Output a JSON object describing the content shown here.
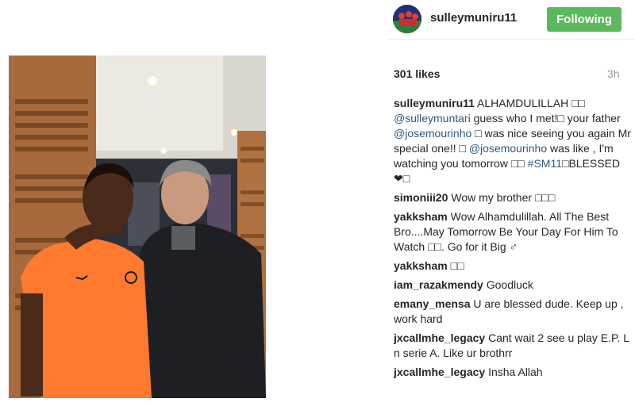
{
  "header": {
    "username": "sulleymuniru11",
    "follow_label": "Following"
  },
  "post": {
    "likes": "301 likes",
    "time": "3h"
  },
  "caption": {
    "user": "sulleymuniru11",
    "t1": " ALHAMDULILLAH □□ ",
    "mention1": "@sulleymuntari",
    "t2": " guess who I met!□ your father ",
    "mention2": "@josemourinho",
    "t3": " □ was nice seeing you again Mr special one!! □ ",
    "mention3": "@josemourinho",
    "t4": " was like , I'm watching you tomorrow □□ ",
    "hashtag": "#SM11",
    "t5": "□BLESSED ❤□"
  },
  "comments": [
    {
      "user": "simoniii20",
      "text": " Wow my brother □□□"
    },
    {
      "user": "yakksham",
      "text": " Wow Alhamdulillah. All The Best Bro....May Tomorrow Be Your Day For Him To Watch □□. Go for it Big ♂"
    },
    {
      "user": "yakksham",
      "text": " □□"
    },
    {
      "user": "iam_razakmendy",
      "text": " Goodluck"
    },
    {
      "user": "emany_mensa",
      "text": " U are blessed dude. Keep up , work hard"
    },
    {
      "user": "jxcallmhe_legacy",
      "text": " Cant wait 2 see u play E.P. L n serie A. Like ur brothrr"
    },
    {
      "user": "jxcallmhe_legacy",
      "text": " Insha Allah"
    }
  ],
  "colors": {
    "follow_button": "#5cb85c",
    "link": "#2b5a83"
  }
}
